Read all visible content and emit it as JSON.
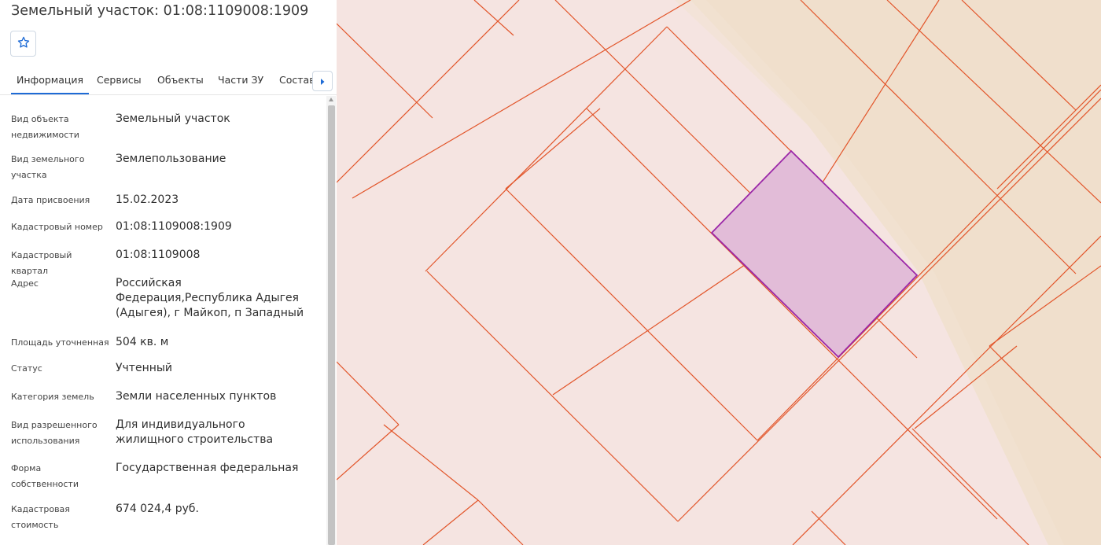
{
  "header": {
    "title": "Земельный участок: 01:08:1109008:1909"
  },
  "tabs": [
    {
      "label": "Информация",
      "active": true
    },
    {
      "label": "Сервисы",
      "active": false
    },
    {
      "label": "Объекты",
      "active": false
    },
    {
      "label": "Части ЗУ",
      "active": false
    },
    {
      "label": "Состав",
      "active": false
    }
  ],
  "info": [
    {
      "label": "Вид объекта недвижимости",
      "value": "Земельный участок"
    },
    {
      "label": "Вид земельного участка",
      "value": "Землепользование"
    },
    {
      "label": "Дата присвоения",
      "value": "15.02.2023"
    },
    {
      "label": "Кадастровый номер",
      "value": "01:08:1109008:1909"
    },
    {
      "label": "Кадастровый квартал",
      "value": "01:08:1109008"
    },
    {
      "label": "Адрес",
      "value": "Российская Федерация,Республика Адыгея (Адыгея), г Майкоп, п Западный"
    },
    {
      "label": "Площадь уточненная",
      "value": "504 кв. м"
    },
    {
      "label": "Статус",
      "value": "Учтенный"
    },
    {
      "label": "Категория земель",
      "value": "Земли населенных пунктов"
    },
    {
      "label": "Вид разрешенного использования",
      "value": "Для индивидуального жилищного строительства"
    },
    {
      "label": "Форма собственности",
      "value": "Государственная федеральная"
    },
    {
      "label": "Кадастровая стоимость",
      "value": "674 024,4 руб."
    }
  ],
  "icons": {
    "favorite": "star-outline-icon",
    "tabs_next": "caret-right-icon"
  },
  "colors": {
    "accent": "#1e6bd6",
    "parcel_line": "#e2552a",
    "selected_fill": "#e2bcd8",
    "selected_stroke": "#9b27a8",
    "map_bg": "#f5e4e1",
    "zone_fill": "#f0dfcc"
  }
}
